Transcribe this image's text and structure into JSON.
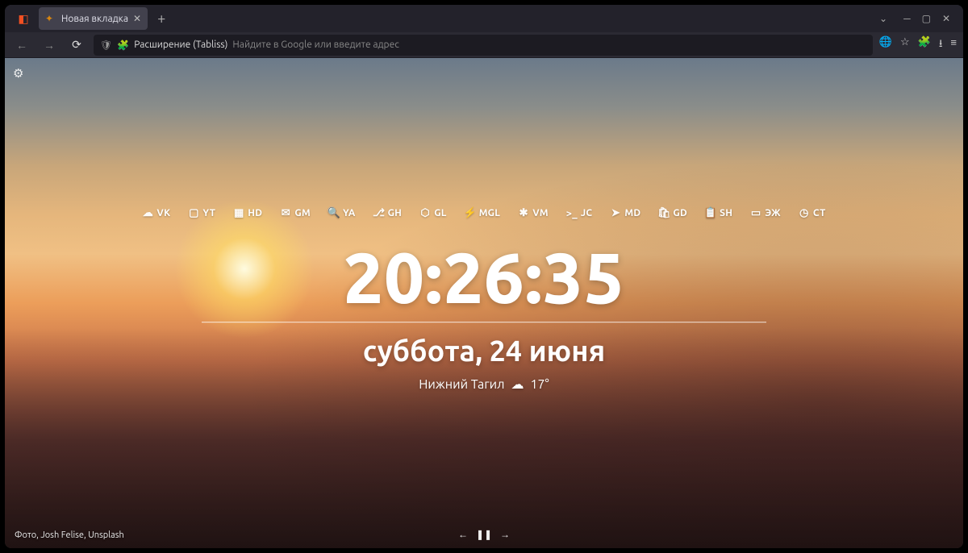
{
  "tab": {
    "title": "Новая вкладка"
  },
  "urlbar": {
    "extension_label": "Расширение (Tabliss)",
    "placeholder": "Найдите в Google или введите адрес"
  },
  "links": [
    {
      "icon": "cloud",
      "label": "VK"
    },
    {
      "icon": "play",
      "label": "YT"
    },
    {
      "icon": "grid",
      "label": "HD"
    },
    {
      "icon": "mail",
      "label": "GM"
    },
    {
      "icon": "search",
      "label": "YA"
    },
    {
      "icon": "github",
      "label": "GH"
    },
    {
      "icon": "gitlab",
      "label": "GL"
    },
    {
      "icon": "bolt",
      "label": "MGL"
    },
    {
      "icon": "slack",
      "label": "VM"
    },
    {
      "icon": "term",
      "label": "JC"
    },
    {
      "icon": "send",
      "label": "MD"
    },
    {
      "icon": "bag",
      "label": "GD"
    },
    {
      "icon": "clip",
      "label": "SH"
    },
    {
      "icon": "book",
      "label": "ЭЖ"
    },
    {
      "icon": "clock",
      "label": "CT"
    }
  ],
  "clock": "20:26:35",
  "date": "суббота, 24 июня",
  "weather": {
    "location": "Нижний Тагил",
    "temp": "17°"
  },
  "credit": "Фото, Josh Felise, Unsplash"
}
